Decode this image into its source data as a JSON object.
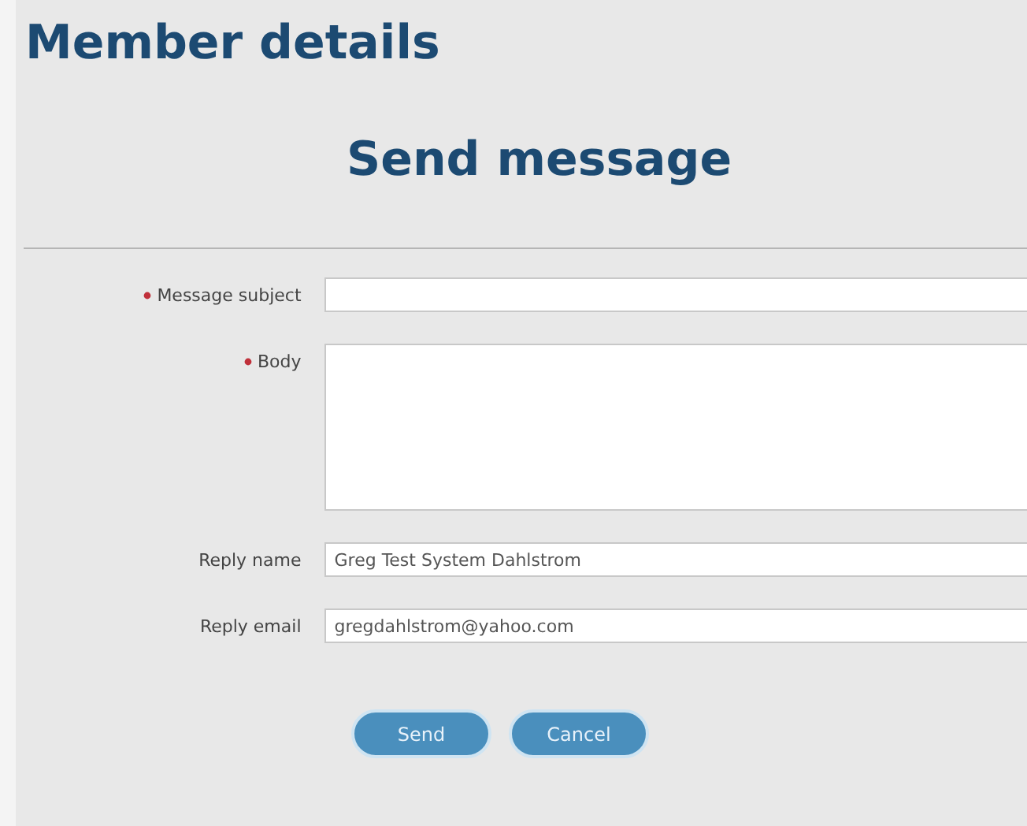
{
  "page_title": "Member details",
  "form": {
    "title": "Send message",
    "fields": [
      {
        "kind": "text",
        "label": "Message subject",
        "required": true
      },
      {
        "kind": "textarea",
        "label": "Body",
        "required": true
      },
      {
        "kind": "text",
        "label": "Reply name",
        "required": false,
        "value": "Greg Test System Dahlstrom"
      },
      {
        "kind": "text",
        "label": "Reply email",
        "required": false,
        "value": "gregdahlstrom@yahoo.com"
      }
    ],
    "buttons": [
      "Send",
      "Cancel"
    ]
  }
}
